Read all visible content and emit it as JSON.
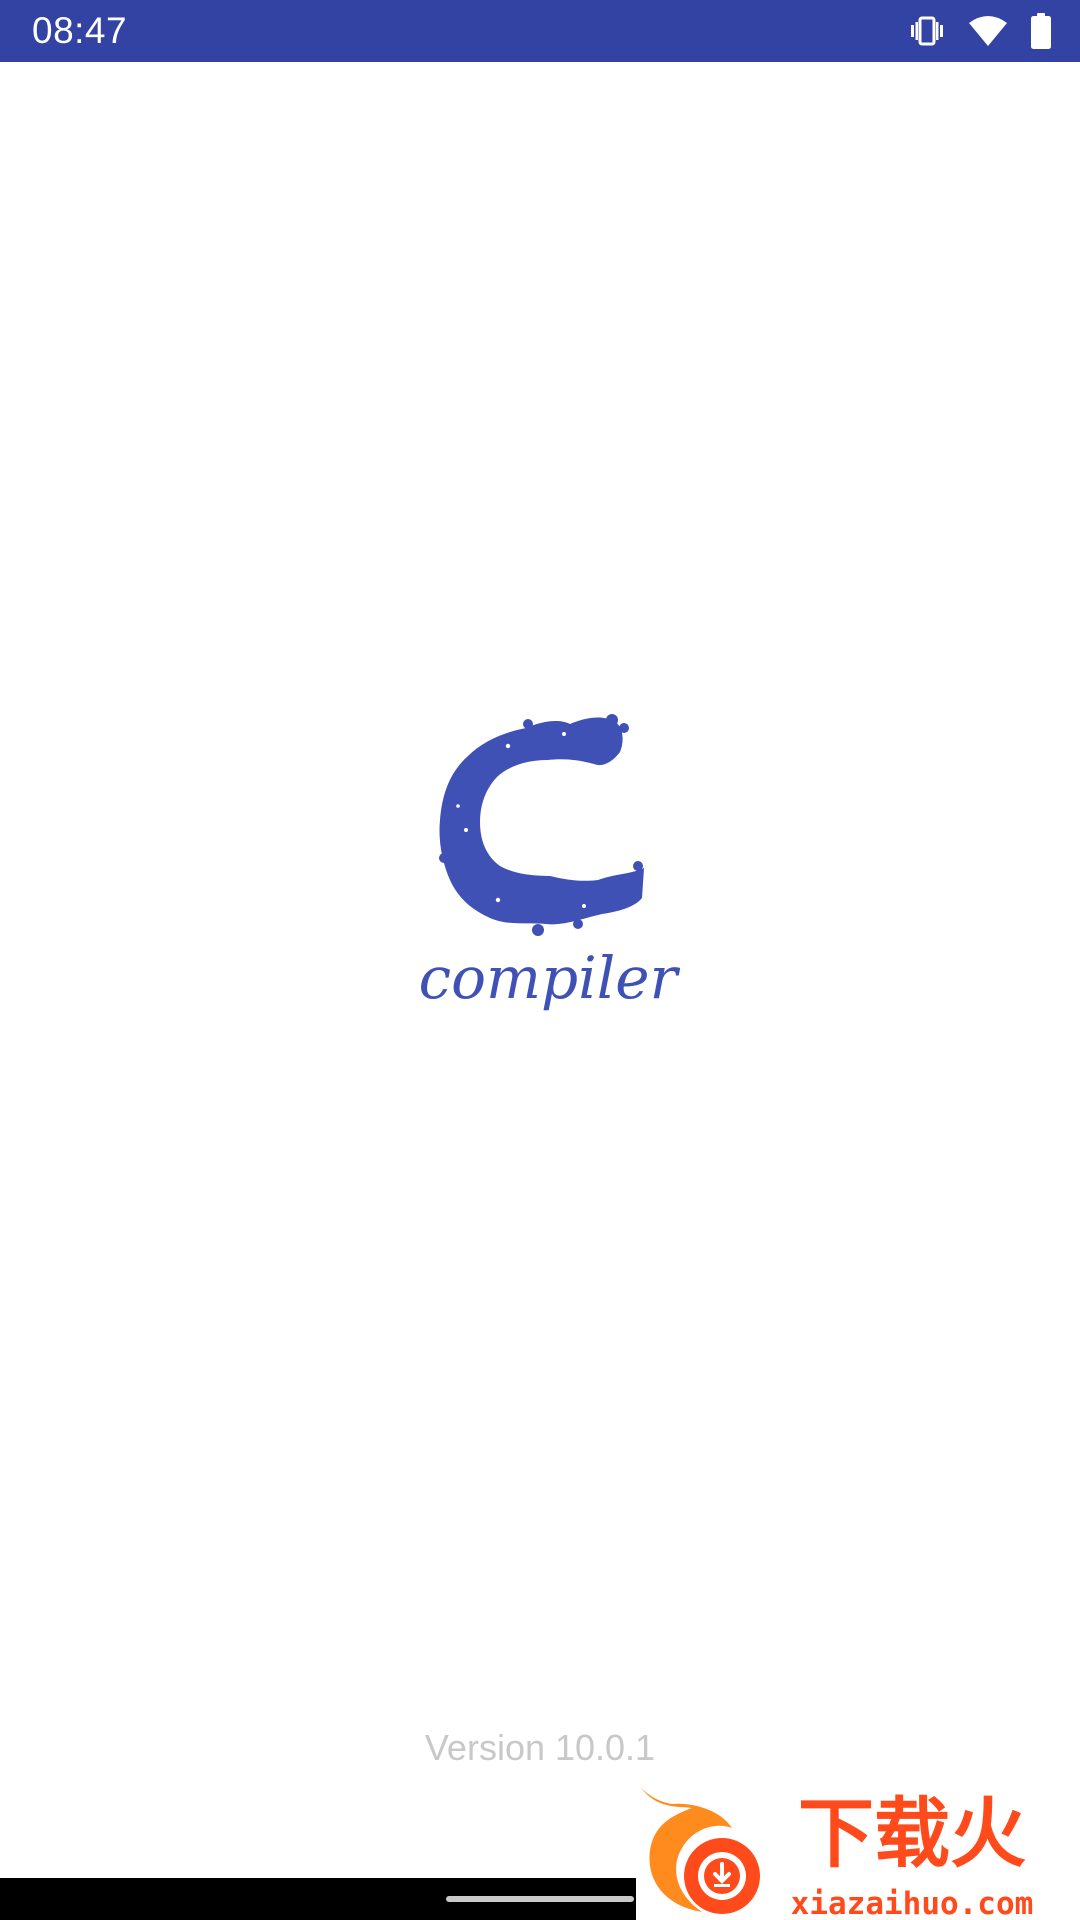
{
  "status_bar": {
    "time": "08:47",
    "icons": [
      "vibrate-icon",
      "wifi-icon",
      "battery-icon"
    ],
    "background_color": "#3343a4"
  },
  "splash": {
    "logo_letter": "C",
    "logo_word": "compiler",
    "logo_color": "#3f51b5",
    "version": "Version 10.0.1"
  },
  "watermark": {
    "brand_chinese": "下载火",
    "brand_domain": "xiazaihuo.com",
    "brand_color": "#ff4a1c"
  },
  "navigation": {
    "handle": "home-handle"
  }
}
